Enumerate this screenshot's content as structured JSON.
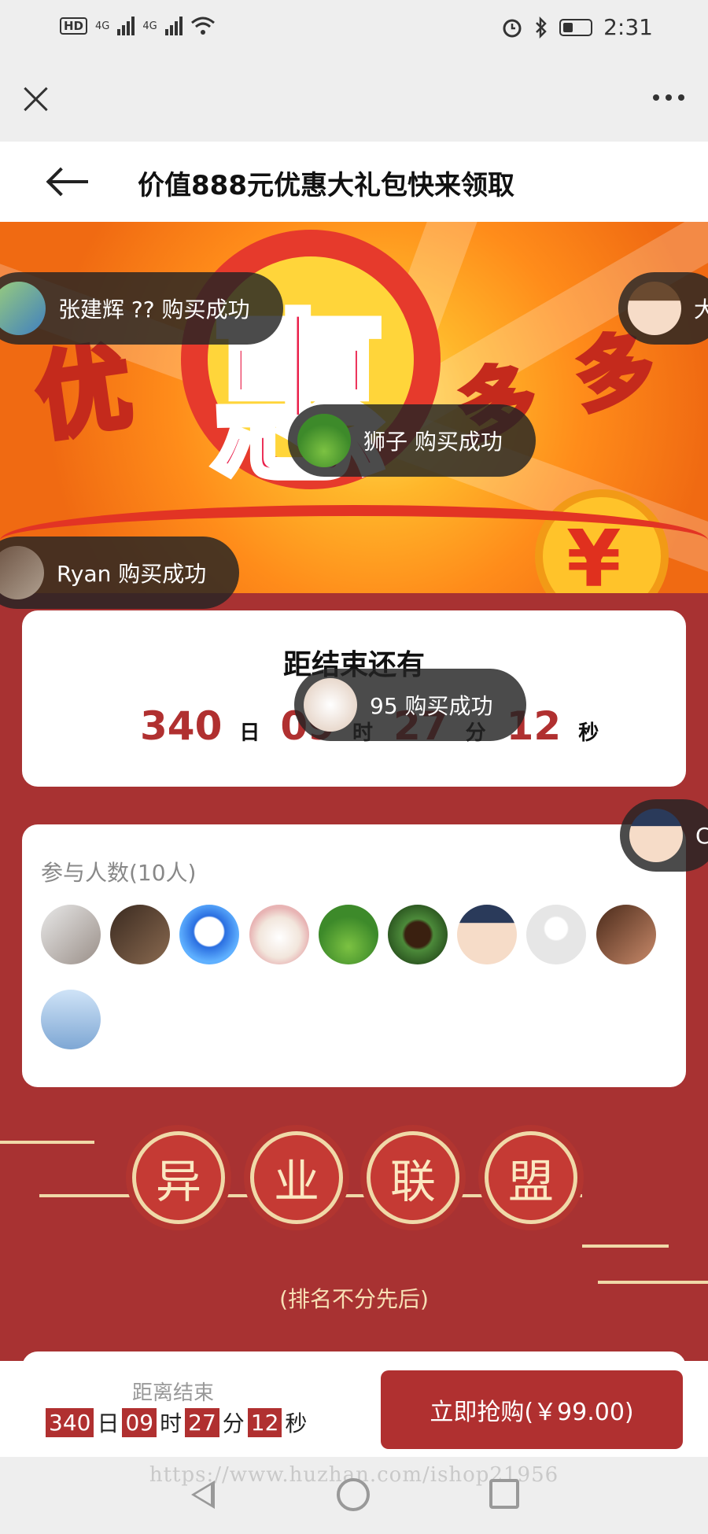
{
  "status_bar": {
    "network_badge": "HD",
    "signal_1": "4G",
    "signal_2": "4G",
    "time": "2:31",
    "icons": [
      "hd-icon",
      "signal-icon",
      "wifi-icon",
      "alarm-icon",
      "bluetooth-icon",
      "battery-icon"
    ]
  },
  "header": {
    "title": "价值888元优惠大礼包快来领取"
  },
  "banner": {
    "text_you": "优",
    "text_hui": "惠",
    "text_duo": "多",
    "coin_symbol": "¥"
  },
  "toasts": [
    {
      "text": "张建辉 ?? 购买成功"
    },
    {
      "text": "狮子 购买成功"
    },
    {
      "text": "Ryan 购买成功"
    },
    {
      "text": "95 购买成功"
    },
    {
      "text": "大"
    },
    {
      "text": "C"
    }
  ],
  "countdown": {
    "title": "距结束还有",
    "days": "340",
    "day_unit": "日",
    "hours": "09",
    "hour_unit": "时",
    "minutes": "27",
    "minute_unit": "分",
    "seconds": "12",
    "second_unit": "秒"
  },
  "participants": {
    "label": "参与人数(10人)",
    "count": 10
  },
  "alliance": {
    "chars": [
      "异",
      "业",
      "联",
      "盟"
    ],
    "note": "(排名不分先后)"
  },
  "bottom_bar": {
    "label": "距离结束",
    "days": "340",
    "day_unit": "日",
    "hours": "09",
    "hour_unit": "时",
    "minutes": "27",
    "minute_unit": "分",
    "seconds": "12",
    "second_unit": "秒",
    "buy_button": "立即抢购(￥99.00)"
  },
  "watermark": "https://www.huzhan.com/ishop21956",
  "colors": {
    "theme_red": "#a83232",
    "accent_red": "#b03030",
    "gold_text": "#f7e0b5"
  }
}
